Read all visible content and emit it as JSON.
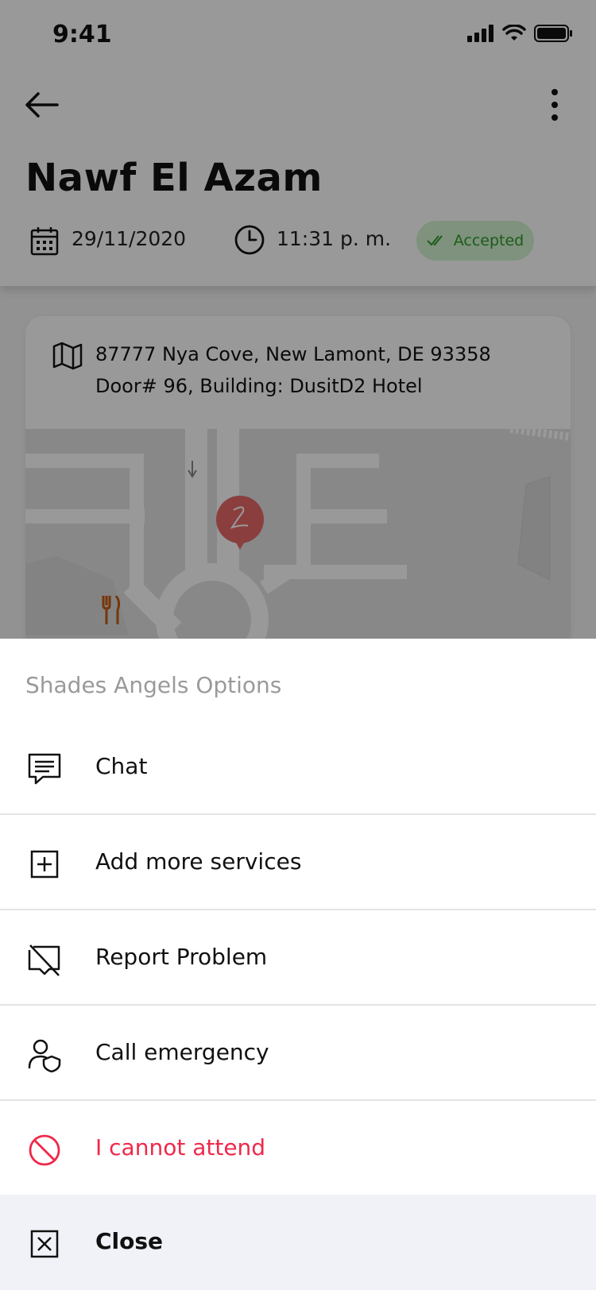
{
  "status_bar": {
    "time": "9:41"
  },
  "header": {
    "client_name": "Nawf El Azam",
    "date": "29/11/2020",
    "time": "11:31 p. m.",
    "status": "Accepted",
    "status_color": "#2f9a2a"
  },
  "address": {
    "line1": "87777 Nya Cove, New Lamont, DE 93358",
    "line2": "Door# 96, Building: DusitD2 Hotel"
  },
  "sheet": {
    "title": "Shades Angels Options",
    "options": [
      {
        "label": "Chat",
        "icon": "chat-icon"
      },
      {
        "label": "Add more services",
        "icon": "plus-square-icon"
      },
      {
        "label": "Report Problem",
        "icon": "report-problem-icon"
      },
      {
        "label": "Call emergency",
        "icon": "emergency-icon"
      },
      {
        "label": "I cannot attend",
        "icon": "block-icon",
        "color": "#f0284a"
      }
    ],
    "close_label": "Close"
  }
}
